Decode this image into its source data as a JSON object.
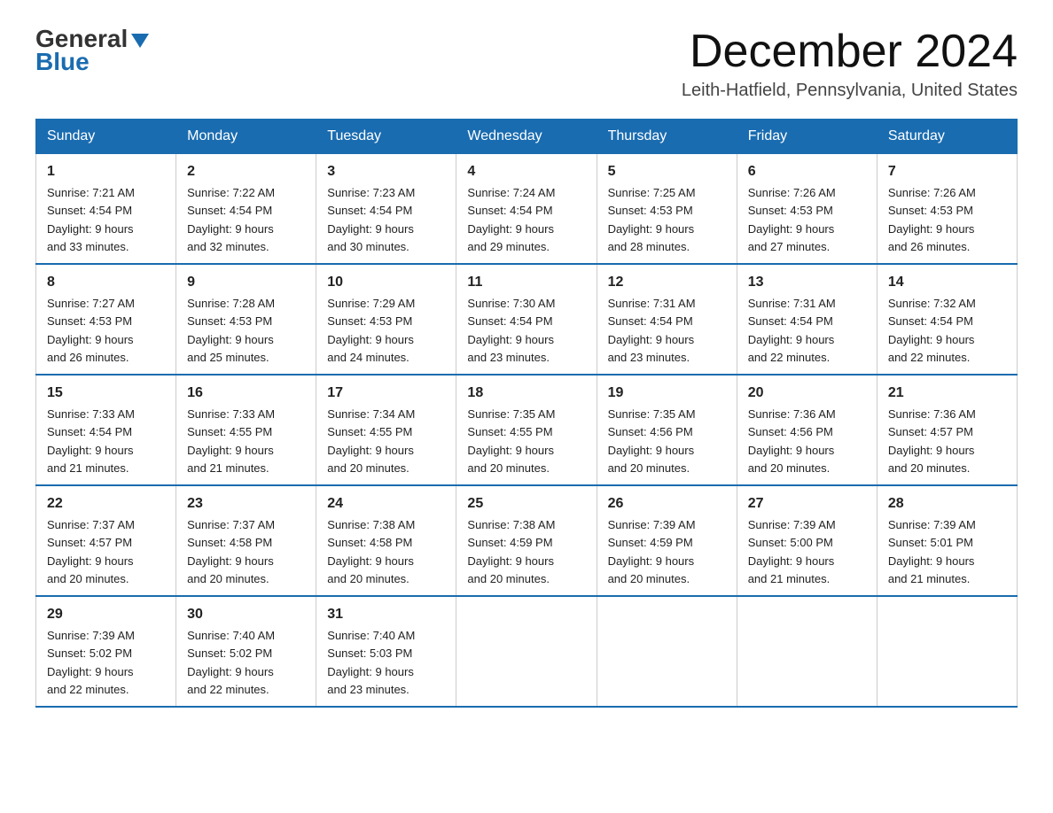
{
  "logo": {
    "general": "General",
    "blue": "Blue"
  },
  "title": "December 2024",
  "subtitle": "Leith-Hatfield, Pennsylvania, United States",
  "days_of_week": [
    "Sunday",
    "Monday",
    "Tuesday",
    "Wednesday",
    "Thursday",
    "Friday",
    "Saturday"
  ],
  "weeks": [
    [
      {
        "day": "1",
        "sunrise": "7:21 AM",
        "sunset": "4:54 PM",
        "daylight": "9 hours and 33 minutes."
      },
      {
        "day": "2",
        "sunrise": "7:22 AM",
        "sunset": "4:54 PM",
        "daylight": "9 hours and 32 minutes."
      },
      {
        "day": "3",
        "sunrise": "7:23 AM",
        "sunset": "4:54 PM",
        "daylight": "9 hours and 30 minutes."
      },
      {
        "day": "4",
        "sunrise": "7:24 AM",
        "sunset": "4:54 PM",
        "daylight": "9 hours and 29 minutes."
      },
      {
        "day": "5",
        "sunrise": "7:25 AM",
        "sunset": "4:53 PM",
        "daylight": "9 hours and 28 minutes."
      },
      {
        "day": "6",
        "sunrise": "7:26 AM",
        "sunset": "4:53 PM",
        "daylight": "9 hours and 27 minutes."
      },
      {
        "day": "7",
        "sunrise": "7:26 AM",
        "sunset": "4:53 PM",
        "daylight": "9 hours and 26 minutes."
      }
    ],
    [
      {
        "day": "8",
        "sunrise": "7:27 AM",
        "sunset": "4:53 PM",
        "daylight": "9 hours and 26 minutes."
      },
      {
        "day": "9",
        "sunrise": "7:28 AM",
        "sunset": "4:53 PM",
        "daylight": "9 hours and 25 minutes."
      },
      {
        "day": "10",
        "sunrise": "7:29 AM",
        "sunset": "4:53 PM",
        "daylight": "9 hours and 24 minutes."
      },
      {
        "day": "11",
        "sunrise": "7:30 AM",
        "sunset": "4:54 PM",
        "daylight": "9 hours and 23 minutes."
      },
      {
        "day": "12",
        "sunrise": "7:31 AM",
        "sunset": "4:54 PM",
        "daylight": "9 hours and 23 minutes."
      },
      {
        "day": "13",
        "sunrise": "7:31 AM",
        "sunset": "4:54 PM",
        "daylight": "9 hours and 22 minutes."
      },
      {
        "day": "14",
        "sunrise": "7:32 AM",
        "sunset": "4:54 PM",
        "daylight": "9 hours and 22 minutes."
      }
    ],
    [
      {
        "day": "15",
        "sunrise": "7:33 AM",
        "sunset": "4:54 PM",
        "daylight": "9 hours and 21 minutes."
      },
      {
        "day": "16",
        "sunrise": "7:33 AM",
        "sunset": "4:55 PM",
        "daylight": "9 hours and 21 minutes."
      },
      {
        "day": "17",
        "sunrise": "7:34 AM",
        "sunset": "4:55 PM",
        "daylight": "9 hours and 20 minutes."
      },
      {
        "day": "18",
        "sunrise": "7:35 AM",
        "sunset": "4:55 PM",
        "daylight": "9 hours and 20 minutes."
      },
      {
        "day": "19",
        "sunrise": "7:35 AM",
        "sunset": "4:56 PM",
        "daylight": "9 hours and 20 minutes."
      },
      {
        "day": "20",
        "sunrise": "7:36 AM",
        "sunset": "4:56 PM",
        "daylight": "9 hours and 20 minutes."
      },
      {
        "day": "21",
        "sunrise": "7:36 AM",
        "sunset": "4:57 PM",
        "daylight": "9 hours and 20 minutes."
      }
    ],
    [
      {
        "day": "22",
        "sunrise": "7:37 AM",
        "sunset": "4:57 PM",
        "daylight": "9 hours and 20 minutes."
      },
      {
        "day": "23",
        "sunrise": "7:37 AM",
        "sunset": "4:58 PM",
        "daylight": "9 hours and 20 minutes."
      },
      {
        "day": "24",
        "sunrise": "7:38 AM",
        "sunset": "4:58 PM",
        "daylight": "9 hours and 20 minutes."
      },
      {
        "day": "25",
        "sunrise": "7:38 AM",
        "sunset": "4:59 PM",
        "daylight": "9 hours and 20 minutes."
      },
      {
        "day": "26",
        "sunrise": "7:39 AM",
        "sunset": "4:59 PM",
        "daylight": "9 hours and 20 minutes."
      },
      {
        "day": "27",
        "sunrise": "7:39 AM",
        "sunset": "5:00 PM",
        "daylight": "9 hours and 21 minutes."
      },
      {
        "day": "28",
        "sunrise": "7:39 AM",
        "sunset": "5:01 PM",
        "daylight": "9 hours and 21 minutes."
      }
    ],
    [
      {
        "day": "29",
        "sunrise": "7:39 AM",
        "sunset": "5:02 PM",
        "daylight": "9 hours and 22 minutes."
      },
      {
        "day": "30",
        "sunrise": "7:40 AM",
        "sunset": "5:02 PM",
        "daylight": "9 hours and 22 minutes."
      },
      {
        "day": "31",
        "sunrise": "7:40 AM",
        "sunset": "5:03 PM",
        "daylight": "9 hours and 23 minutes."
      },
      null,
      null,
      null,
      null
    ]
  ]
}
